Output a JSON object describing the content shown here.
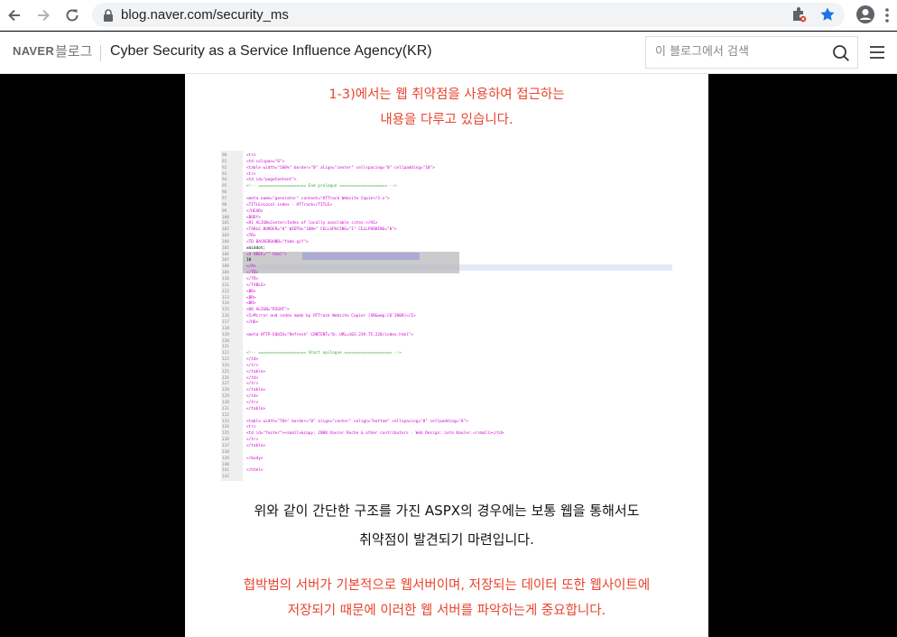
{
  "browser": {
    "url": "blog.naver.com/security_ms"
  },
  "blog": {
    "logo": "NAVER",
    "blog_word": "블로그",
    "title": "Cyber Security as a Service Influence Agency(KR)",
    "search_placeholder": "이 블로그에서 검색"
  },
  "content": {
    "para1_line1": "1-3)에서는 웹 취약점을 사용하여 접근하는",
    "para1_line2": "내용을 다루고 있습니다.",
    "para2_line1": "위와 같이 간단한 구조를 가진 ASPX의 경우에는 보통 웹을 통해서도",
    "para2_line2": "취약점이 발견되기 마련입니다.",
    "para3_line1": "협박범의 서버가 기본적으로 웹서버이며, 저장되는 데이터 또한 웹사이트에",
    "para3_line2": "저장되기 때문에 이러한 웹 서버를 파악하는게 중요합니다."
  },
  "code_lines": [
    {
      "n": "90",
      "t": "    <tr>",
      "c": "#c0c"
    },
    {
      "n": "91",
      "t": "    <td colspan=\"6\">",
      "c": "#c0c"
    },
    {
      "n": "92",
      "t": "        <table width=\"100%\" border=\"0\" align=\"center\" cellspacing=\"0\" cellpadding=\"10\">",
      "c": "#c0c"
    },
    {
      "n": "93",
      "t": "        <tr>",
      "c": "#c0c"
    },
    {
      "n": "94",
      "t": "        <td id=\"pageContent\">",
      "c": "#c0c"
    },
    {
      "n": "95",
      "t": "<!-- ==================== End prologue ==================== -->",
      "c": "#3a3"
    },
    {
      "n": "96",
      "t": "",
      "c": "#000"
    },
    {
      "n": "97",
      "t": "    <meta name=\"generator\" content=\"HTTrack Website Copier/3.x\">",
      "c": "#c0c"
    },
    {
      "n": "98",
      "t": "    <TITLE>Local index - HTTrack</TITLE>",
      "c": "#c0c"
    },
    {
      "n": "99",
      "t": "</HEAD>",
      "c": "#c0c"
    },
    {
      "n": "100",
      "t": "<BODY>",
      "c": "#c0c"
    },
    {
      "n": "101",
      "t": " <H1 ALIGN=Center>Index of locally available sites:</H1>",
      "c": "#c0c"
    },
    {
      "n": "102",
      "t": "    <TABLE BORDER=\"0\" WIDTH=\"100%\" CELLSPACING=\"1\" CELLPADDING=\"0\">",
      "c": "#c0c"
    },
    {
      "n": "103",
      "t": "        <TR>",
      "c": "#c0c"
    },
    {
      "n": "104",
      "t": "            <TD BACKGROUND=\"fade.gif\">",
      "c": "#c0c"
    },
    {
      "n": "105",
      "t": "                xmiddot;",
      "c": "#000"
    },
    {
      "n": "106",
      "t": "                    <A HREF=\"\"          html\">",
      "c": "#c0c"
    },
    {
      "n": "107",
      "t": "                        10",
      "c": "#000"
    },
    {
      "n": "108",
      "t": "                    </A>",
      "c": "#c0c"
    },
    {
      "n": "109",
      "t": "            </TD>",
      "c": "#c0c"
    },
    {
      "n": "110",
      "t": "        </TR>",
      "c": "#c0c"
    },
    {
      "n": "111",
      "t": "    </TABLE>",
      "c": "#c0c"
    },
    {
      "n": "112",
      "t": "    <BR>",
      "c": "#c0c"
    },
    {
      "n": "113",
      "t": "    <BR>",
      "c": "#c0c"
    },
    {
      "n": "114",
      "t": "    <BR>",
      "c": "#c0c"
    },
    {
      "n": "115",
      "t": "    <H6 ALIGN=\"RIGHT\">",
      "c": "#c0c"
    },
    {
      "n": "116",
      "t": "    <I>Mirror and index made by HTTrack Website Copier [XR&amp;CO'2008]</I>",
      "c": "#c0c"
    },
    {
      "n": "117",
      "t": "    </H6>",
      "c": "#c0c"
    },
    {
      "n": "118",
      "t": "",
      "c": "#000"
    },
    {
      "n": "119",
      "t": "    <meta HTTP-EQUIV=\"Refresh\" CONTENT=\"0; URL=103.239.75.228/index.html\">",
      "c": "#c0c"
    },
    {
      "n": "120",
      "t": "",
      "c": "#000"
    },
    {
      "n": "121",
      "t": "",
      "c": "#000"
    },
    {
      "n": "122",
      "t": "<!-- ==================== Start epilogue ==================== -->",
      "c": "#3a3"
    },
    {
      "n": "123",
      "t": "            </td>",
      "c": "#c0c"
    },
    {
      "n": "124",
      "t": "            </tr>",
      "c": "#c0c"
    },
    {
      "n": "125",
      "t": "            </table>",
      "c": "#c0c"
    },
    {
      "n": "126",
      "t": "        </td>",
      "c": "#c0c"
    },
    {
      "n": "127",
      "t": "        </tr>",
      "c": "#c0c"
    },
    {
      "n": "128",
      "t": "        </table>",
      "c": "#c0c"
    },
    {
      "n": "129",
      "t": "    </td>",
      "c": "#c0c"
    },
    {
      "n": "130",
      "t": "    </tr>",
      "c": "#c0c"
    },
    {
      "n": "131",
      "t": "    </table>",
      "c": "#c0c"
    },
    {
      "n": "132",
      "t": "",
      "c": "#000"
    },
    {
      "n": "133",
      "t": "<table width=\"76%\" border=\"0\" align=\"center\" valign=\"bottom\" cellspacing=\"0\" cellpadding=\"0\">",
      "c": "#c0c"
    },
    {
      "n": "134",
      "t": "    <tr>",
      "c": "#c0c"
    },
    {
      "n": "135",
      "t": "    <td id=\"footer\"><small>&copy; 2008 Xavier Roche & other contributors - Web Design: Leto Kauler.</small></td>",
      "c": "#c0c"
    },
    {
      "n": "136",
      "t": "    </tr>",
      "c": "#c0c"
    },
    {
      "n": "137",
      "t": "</table>",
      "c": "#c0c"
    },
    {
      "n": "138",
      "t": "",
      "c": "#000"
    },
    {
      "n": "139",
      "t": "</body>",
      "c": "#c0c"
    },
    {
      "n": "140",
      "t": "",
      "c": "#000"
    },
    {
      "n": "141",
      "t": "</html>",
      "c": "#c0c"
    },
    {
      "n": "142",
      "t": "",
      "c": "#000"
    }
  ]
}
